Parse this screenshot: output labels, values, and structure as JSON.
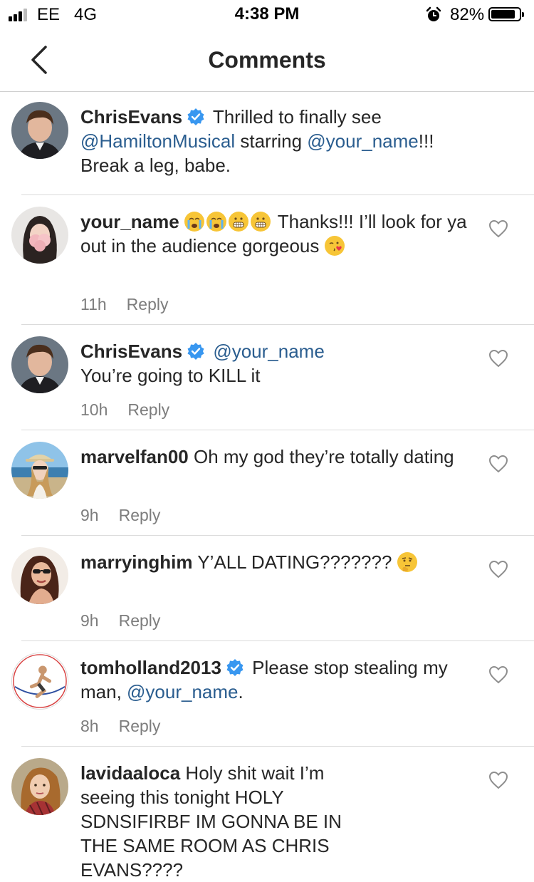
{
  "status_bar": {
    "carrier": "EE",
    "network": "4G",
    "time": "4:38 PM",
    "battery": "82%",
    "icons": [
      "signal-icon",
      "alarm-icon",
      "battery-icon"
    ]
  },
  "header": {
    "title": "Comments",
    "back_icon": "chevron-left-icon"
  },
  "colors": {
    "mention": "#2a5d8f",
    "verified": "#3897f0",
    "meta_text": "#7d7d7d",
    "divider": "#dbdbdb"
  },
  "comments": [
    {
      "username": "ChrisEvans",
      "verified": true,
      "segments": [
        {
          "text": " Thrilled to finally see "
        },
        {
          "mention": "@HamiltonMusical"
        },
        {
          "text": " starring "
        },
        {
          "mention": "@your_name"
        },
        {
          "text": "!!! Break a leg, babe."
        }
      ],
      "time": "",
      "reply": "",
      "liked_icon": false
    },
    {
      "username": "your_name",
      "verified": false,
      "emoji_prefix": [
        "loudly-crying-face",
        "loudly-crying-face",
        "grimacing-face",
        "grimacing-face"
      ],
      "text": " Thanks!!! I’ll look for ya out in the audience gorgeous ",
      "emoji_suffix": [
        "face-blowing-kiss"
      ],
      "time": "11h",
      "reply": "Reply"
    },
    {
      "username": "ChrisEvans",
      "verified": true,
      "mention": "@your_name",
      "text": "You’re going to KILL it",
      "time": "10h",
      "reply": "Reply"
    },
    {
      "username": "marvelfan00",
      "text": " Oh my god they’re totally dating",
      "time": "9h",
      "reply": "Reply"
    },
    {
      "username": "marryinghim",
      "text": " Y’ALL DATING??????? ",
      "emoji_suffix": [
        "thinking-face"
      ],
      "time": "9h",
      "reply": "Reply"
    },
    {
      "username": "tomholland2013",
      "verified": true,
      "text_before": " Please stop stealing my man, ",
      "mention": "@your_name",
      "text_after": ".",
      "time": "8h",
      "reply": "Reply"
    },
    {
      "username": "lavidaaloca",
      "text": " Holy shit wait I’m seeing this tonight HOLY SDNSIFIRBF IM GONNA BE IN THE SAME ROOM AS CHRIS EVANS????",
      "time": "",
      "reply": ""
    }
  ]
}
